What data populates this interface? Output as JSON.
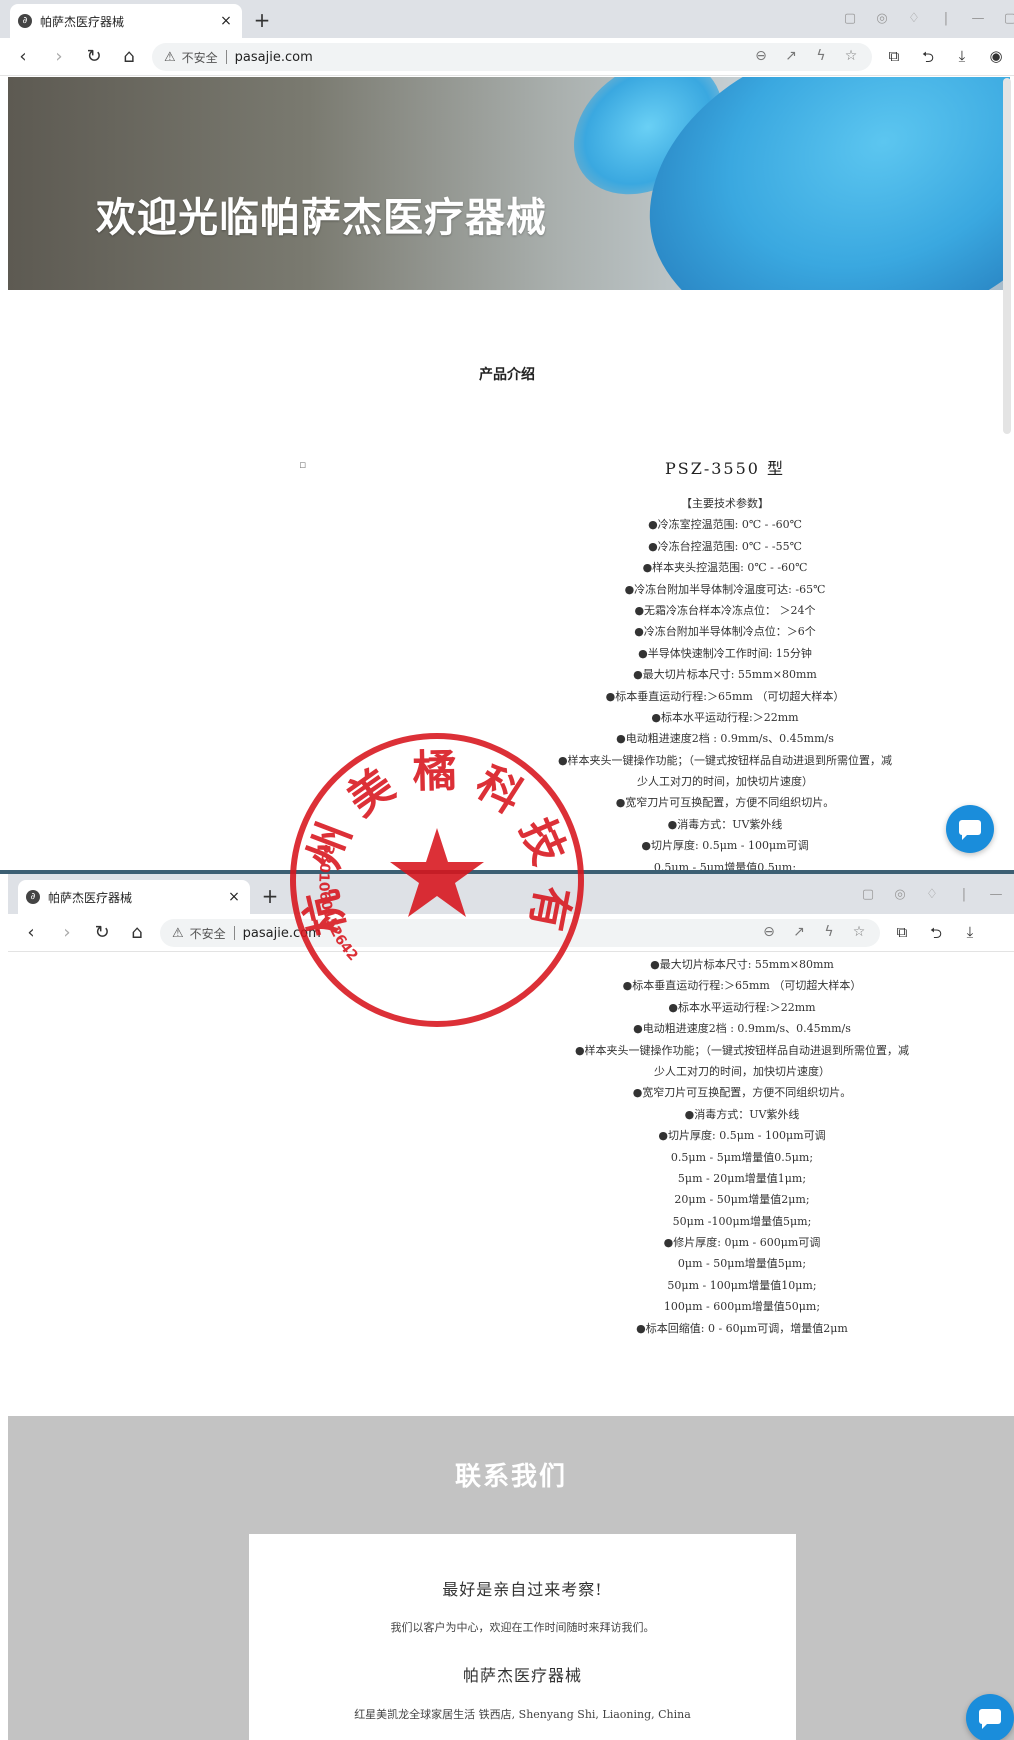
{
  "browser": {
    "tab_title": "帕萨杰医疗器械",
    "tab_close": "×",
    "new_tab": "+",
    "insecure_label": "不安全",
    "url": "pasajie.com"
  },
  "hero": {
    "headline": "欢迎光临帕萨杰医疗器械"
  },
  "products": {
    "section_title": "产品介绍",
    "model": "PSZ-3550 型",
    "spec_lines": [
      "【主要技术参数】",
      "●冷冻室控温范围: 0℃ - -60℃",
      "●冷冻台控温范围: 0℃ - -55℃",
      "●样本夹头控温范围: 0℃ - -60℃",
      "●冷冻台附加半导体制冷温度可达: -65℃",
      "●无霜冷冻台样本冷冻点位： ＞24个",
      "●冷冻台附加半导体制冷点位：＞6个",
      "●半导体快速制冷工作时间: 15分钟",
      "●最大切片标本尺寸: 55mm×80mm",
      "●标本垂直运动行程:＞65mm （可切超大样本）",
      "●标本水平运动行程:＞22mm",
      "●电动粗进速度2档 : 0.9mm/s、0.45mm/s",
      "●样本夹头一键操作功能；（一键式按钮样品自动进退到所需位置，减",
      "少人工对刀的时间，加快切片速度）",
      "●宽窄刀片可互换配置，方便不同组织切片。",
      "●消毒方式：UV紫外线",
      "●切片厚度: 0.5μm - 100μm可调",
      "0.5μm - 5μm增量值0.5μm;",
      "5μm - 20μm增量值1μm;",
      "20μm - 50μm增量值2μm;",
      "50μm -100μm增量值5μm;",
      "●修片厚度: 0μm - 600μm可调",
      "0μm - 50μm增量值5μm;",
      "50μm - 100μm增量值10μm;",
      "100μm - 600μm增量值50μm;",
      "●标本回缩值: 0 - 60μm可调，增量值2μm"
    ]
  },
  "contact": {
    "title": "联系我们",
    "visit_heading": "最好是亲自过来考察!",
    "visit_text": "我们以客户为中心，欢迎在工作时间随时来拜访我们。",
    "company_name": "帕萨杰医疗器械",
    "address": "红星美凯龙全球家居生活 铁西店, Shenyang Shi, Liaoning, China"
  },
  "seal": {
    "text": "杭州美橘科技有限公司",
    "number": "3301060152642",
    "color": "#d8141c"
  },
  "colors": {
    "chat_button": "#1a8ddb",
    "contact_bg": "#c3c3c3"
  }
}
